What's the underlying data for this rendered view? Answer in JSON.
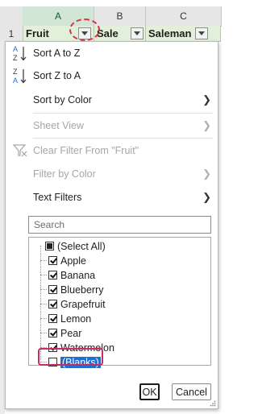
{
  "sheet": {
    "columns": [
      "A",
      "B",
      "C"
    ],
    "row_number": "1",
    "headers": [
      "Fruit",
      "Sale",
      "Saleman"
    ]
  },
  "menu": {
    "sort_az": "Sort A to Z",
    "sort_za": "Sort Z to A",
    "sort_by_color": "Sort by Color",
    "sheet_view": "Sheet View",
    "clear_filter": "Clear Filter From \"Fruit\"",
    "filter_by_color": "Filter by Color",
    "text_filters": "Text Filters",
    "search_placeholder": "Search",
    "items": [
      {
        "label": "(Select All)",
        "state": "partial"
      },
      {
        "label": "Apple",
        "state": "checked"
      },
      {
        "label": "Banana",
        "state": "checked"
      },
      {
        "label": "Blueberry",
        "state": "checked"
      },
      {
        "label": "Grapefruit",
        "state": "checked"
      },
      {
        "label": "Lemon",
        "state": "checked"
      },
      {
        "label": "Pear",
        "state": "checked"
      },
      {
        "label": "Watermelon",
        "state": "checked"
      },
      {
        "label": "(Blanks)",
        "state": "unchecked"
      }
    ],
    "ok_label": "OK",
    "cancel_label": "Cancel"
  },
  "colors": {
    "accent_green": "#217346",
    "header_fill": "#e2efda",
    "highlight_box": "#c72c63",
    "selection_blue": "#1f6fd1"
  }
}
